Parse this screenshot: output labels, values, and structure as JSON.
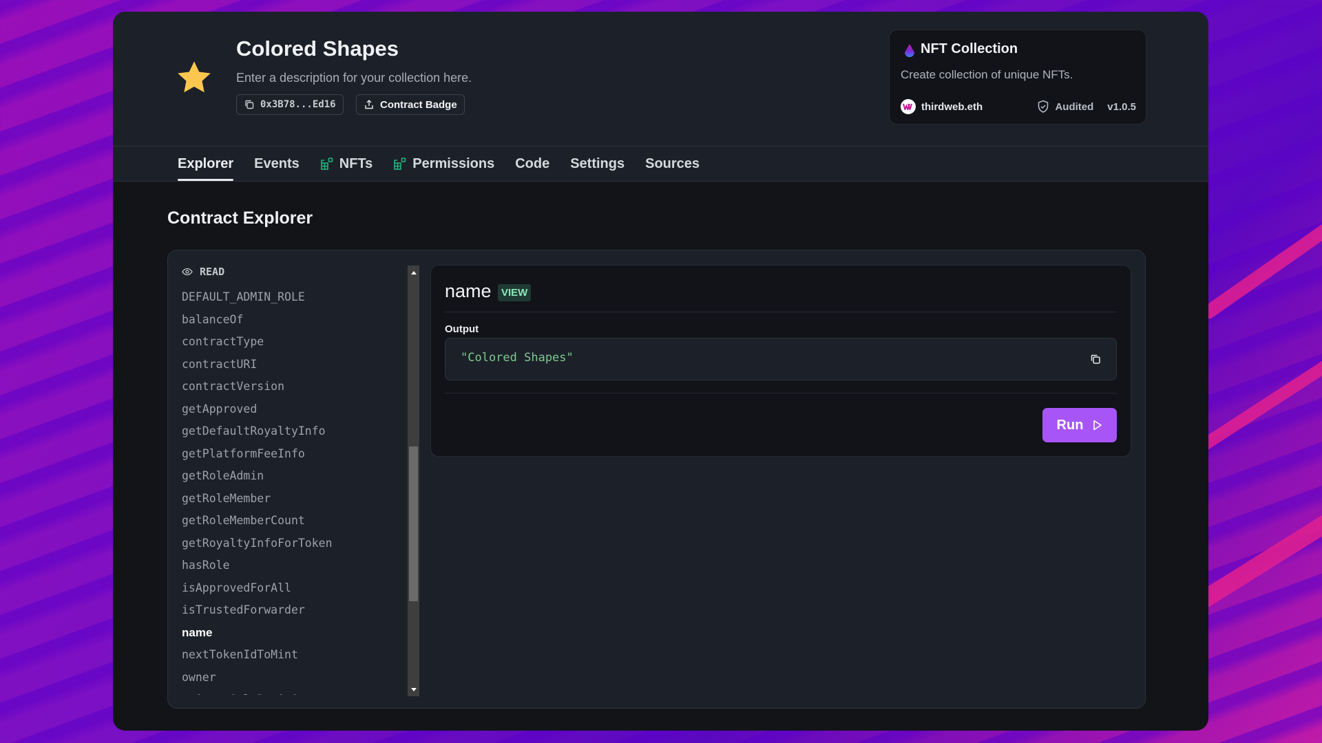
{
  "collection": {
    "title": "Colored Shapes",
    "description": "Enter a description for your collection here.",
    "address_short": "0x3B78...Ed16",
    "badge_button": "Contract Badge",
    "icon": "star-icon"
  },
  "contract_card": {
    "title": "NFT Collection",
    "description": "Create collection of unique NFTs.",
    "publisher": "thirdweb.eth",
    "audit_status": "Audited",
    "version": "v1.0.5"
  },
  "nav": {
    "tabs": [
      {
        "label": "Explorer",
        "active": true
      },
      {
        "label": "Events"
      },
      {
        "label": "NFTs",
        "icon": "extension-icon"
      },
      {
        "label": "Permissions",
        "icon": "extension-icon"
      },
      {
        "label": "Code"
      },
      {
        "label": "Settings"
      },
      {
        "label": "Sources"
      }
    ]
  },
  "explorer": {
    "title": "Contract Explorer",
    "section_label": "READ",
    "functions": [
      "DEFAULT_ADMIN_ROLE",
      "balanceOf",
      "contractType",
      "contractURI",
      "contractVersion",
      "getApproved",
      "getDefaultRoyaltyInfo",
      "getPlatformFeeInfo",
      "getRoleAdmin",
      "getRoleMember",
      "getRoleMemberCount",
      "getRoyaltyInfoForToken",
      "hasRole",
      "isApprovedForAll",
      "isTrustedForwarder",
      "name",
      "nextTokenIdToMint",
      "owner",
      "primarySaleRecipient"
    ],
    "selected_function": "name",
    "selected": {
      "name": "name",
      "badge": "VIEW",
      "output_label": "Output",
      "output_value": "\"Colored Shapes\"",
      "run_label": "Run"
    }
  },
  "colors": {
    "accent": "#a855f7",
    "star": "#fcc74f",
    "view_badge": "#8ee8bd",
    "output_text": "#7fc88f"
  }
}
